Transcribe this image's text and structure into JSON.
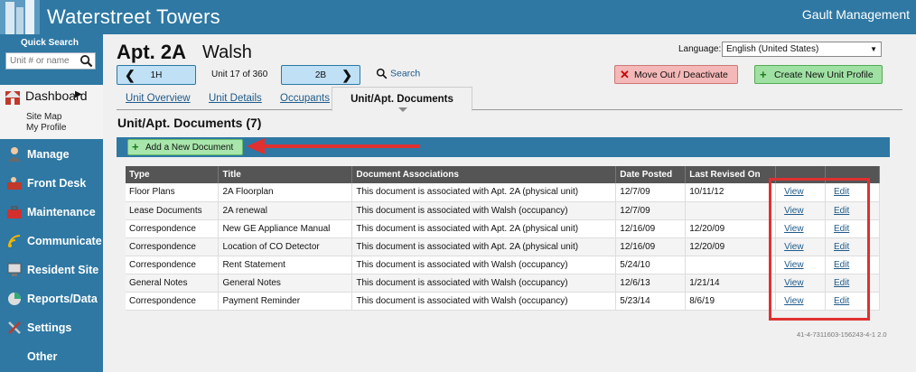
{
  "header": {
    "app_title": "Waterstreet Towers",
    "company": "Gault Management"
  },
  "sidebar": {
    "quick_search_label": "Quick Search",
    "quick_search_placeholder": "Unit # or name",
    "dashboard": {
      "label": "Dashboard",
      "arrow": "▶",
      "links": [
        "Site Map",
        "My Profile"
      ]
    },
    "items": [
      {
        "label": "Manage",
        "icon": "user-icon"
      },
      {
        "label": "Front Desk",
        "icon": "desk-icon"
      },
      {
        "label": "Maintenance",
        "icon": "toolbox-icon"
      },
      {
        "label": "Communicate",
        "icon": "broadcast-icon"
      },
      {
        "label": "Resident Site",
        "icon": "monitor-icon"
      },
      {
        "label": "Reports/Data",
        "icon": "chart-icon"
      },
      {
        "label": "Settings",
        "icon": "tools-icon"
      },
      {
        "label": "Other",
        "icon": ""
      }
    ]
  },
  "unit": {
    "title": "Apt. 2A",
    "resident": "Walsh",
    "prev_unit": "1H",
    "next_unit": "2B",
    "position_text": "Unit 17 of 360",
    "search_label": "Search"
  },
  "language": {
    "label": "Language:",
    "selected": "English (United States)"
  },
  "actions": {
    "move_out": "Move Out / Deactivate",
    "create_unit": "Create New Unit Profile",
    "add_document": "Add a New Document"
  },
  "tabs": {
    "overview": "Unit Overview",
    "details": "Unit Details",
    "occupants": "Occupants",
    "documents": "Unit/Apt. Documents"
  },
  "section_title": "Unit/Apt. Documents (7)",
  "table": {
    "headers": [
      "Type",
      "Title",
      "Document Associations",
      "Date Posted",
      "Last Revised On",
      "",
      ""
    ],
    "rows": [
      {
        "type": "Floor Plans",
        "title": "2A Floorplan",
        "assoc": "This document is associated with Apt. 2A (physical unit)",
        "posted": "12/7/09",
        "revised": "10/11/12",
        "view": "View",
        "edit": "Edit"
      },
      {
        "type": "Lease Documents",
        "title": "2A renewal",
        "assoc": "This document is associated with Walsh (occupancy)",
        "posted": "12/7/09",
        "revised": "",
        "view": "View",
        "edit": "Edit"
      },
      {
        "type": "Correspondence",
        "title": "New GE Appliance Manual",
        "assoc": "This document is associated with Apt. 2A (physical unit)",
        "posted": "12/16/09",
        "revised": "12/20/09",
        "view": "View",
        "edit": "Edit"
      },
      {
        "type": "Correspondence",
        "title": "Location of CO Detector",
        "assoc": "This document is associated with Apt. 2A (physical unit)",
        "posted": "12/16/09",
        "revised": "12/20/09",
        "view": "View",
        "edit": "Edit"
      },
      {
        "type": "Correspondence",
        "title": "Rent Statement",
        "assoc": "This document is associated with Walsh (occupancy)",
        "posted": "5/24/10",
        "revised": "",
        "view": "View",
        "edit": "Edit"
      },
      {
        "type": "General Notes",
        "title": "General Notes",
        "assoc": "This document is associated with Walsh (occupancy)",
        "posted": "12/6/13",
        "revised": "1/21/14",
        "view": "View",
        "edit": "Edit"
      },
      {
        "type": "Correspondence",
        "title": "Payment Reminder",
        "assoc": "This document is associated with Walsh (occupancy)",
        "posted": "5/23/14",
        "revised": "8/6/19",
        "view": "View",
        "edit": "Edit"
      }
    ]
  },
  "version": "41-4-7311603-156243-4-1 2.0",
  "colors": {
    "brand_blue": "#2e78a3",
    "highlight_red": "#e03030",
    "add_green": "#a8e6ac",
    "move_out_red": "#f5b8b8"
  }
}
